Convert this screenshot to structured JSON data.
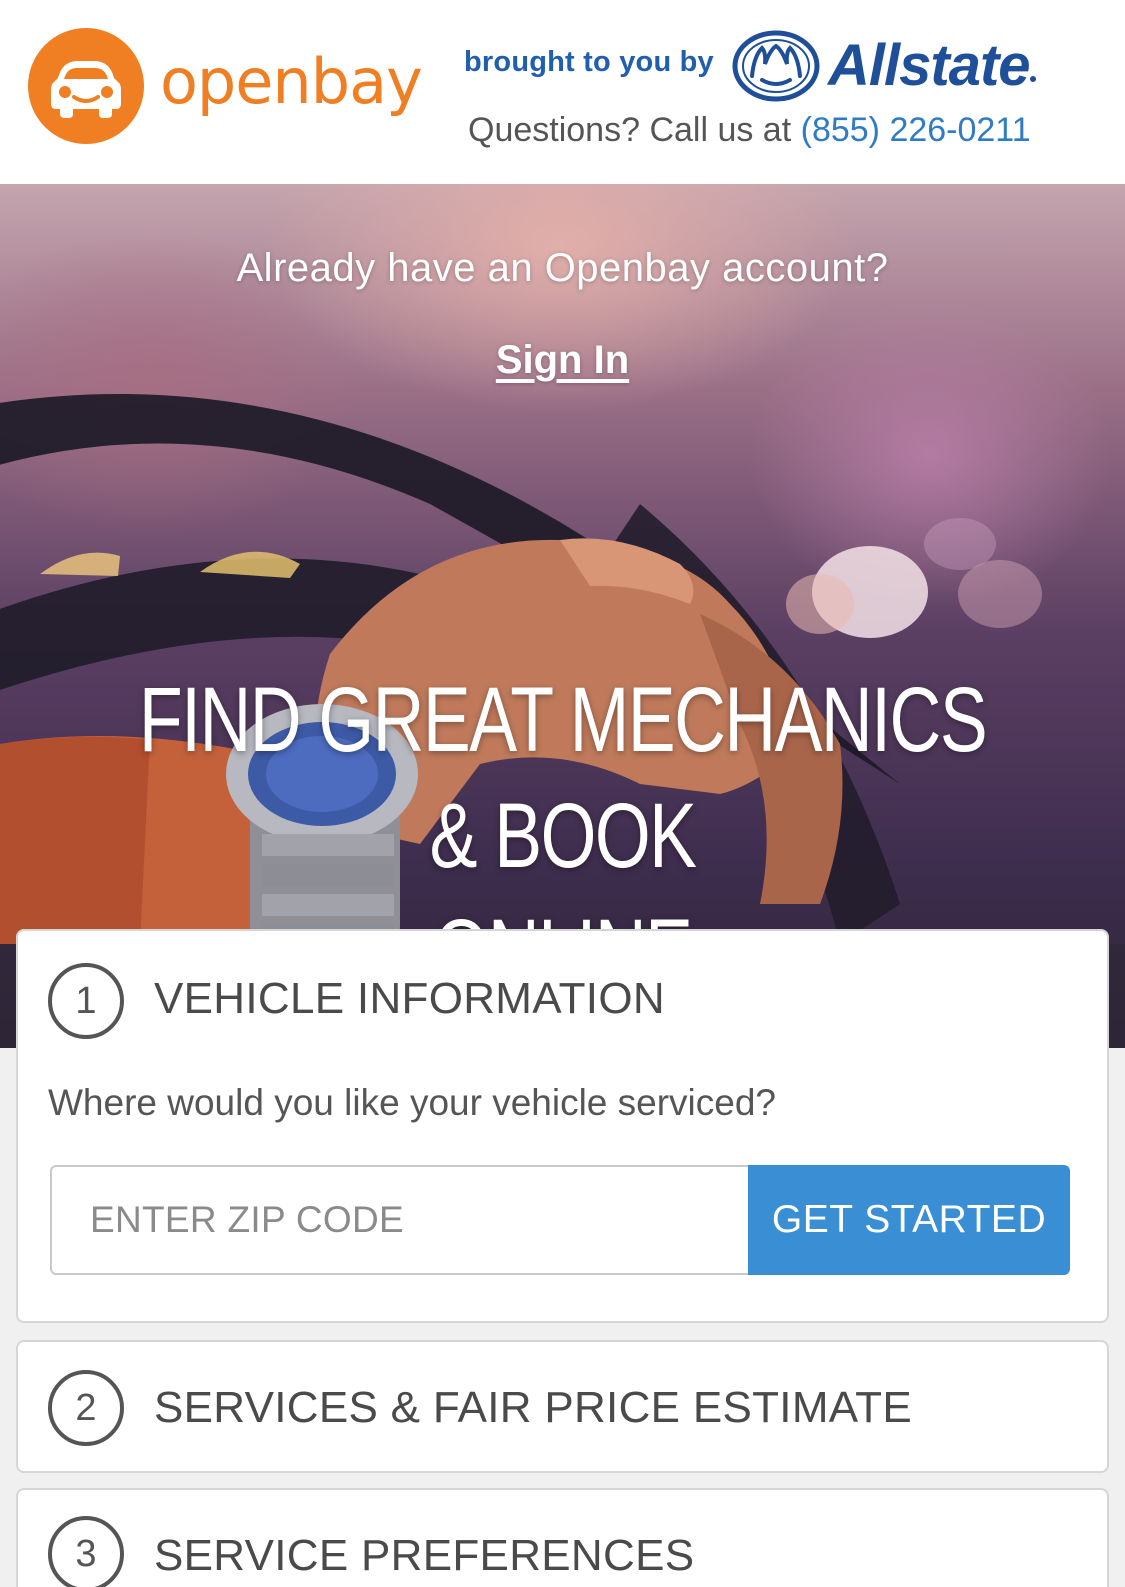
{
  "header": {
    "logo_icon": "car-face-icon",
    "brand": "openbay",
    "brought_by": "brought to you by",
    "partner_logo_icon": "hands-logo-icon",
    "partner": "Allstate",
    "questions_prefix": "Questions? Call us at ",
    "phone": "(855) 226-0211"
  },
  "hero": {
    "already": "Already have an Openbay account?",
    "signin": "Sign In",
    "headline_line1": "FIND GREAT MECHANICS & BOOK",
    "headline_line2": "ONLINE"
  },
  "steps": [
    {
      "number": "1",
      "title": "VEHICLE INFORMATION"
    },
    {
      "number": "2",
      "title": "SERVICES & FAIR PRICE ESTIMATE"
    },
    {
      "number": "3",
      "title": "SERVICE PREFERENCES"
    }
  ],
  "vehicle_form": {
    "question": "Where would you like your vehicle serviced?",
    "zip_placeholder": "ENTER ZIP CODE",
    "zip_value": "",
    "button": "GET STARTED"
  },
  "colors": {
    "brand_orange": "#ef7f22",
    "allstate_blue": "#1e4f98",
    "phone_link": "#2f7cc4",
    "button_blue": "#3a8fd4"
  }
}
